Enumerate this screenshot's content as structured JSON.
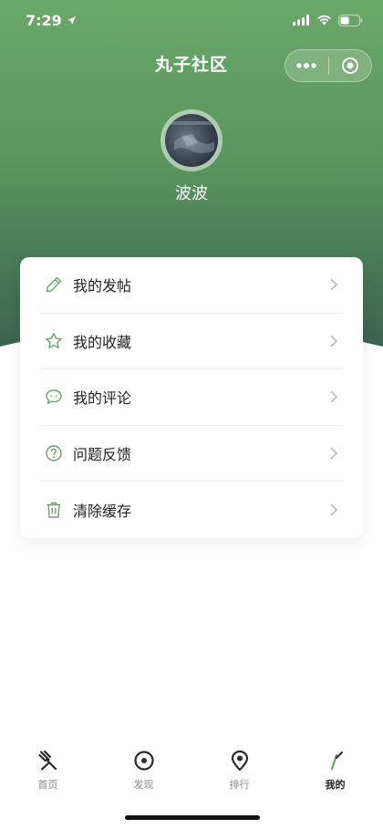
{
  "status": {
    "time": "7:29"
  },
  "app": {
    "title": "丸子社区"
  },
  "user": {
    "name": "波波"
  },
  "colors": {
    "accent": "#6aa06a",
    "hero_top": "#5e9a62",
    "hero_bottom": "#3c6b52"
  },
  "menu": [
    {
      "label": "我的发帖",
      "icon": "pencil-icon"
    },
    {
      "label": "我的收藏",
      "icon": "star-icon"
    },
    {
      "label": "我的评论",
      "icon": "comment-icon"
    },
    {
      "label": "问题反馈",
      "icon": "question-icon"
    },
    {
      "label": "清除缓存",
      "icon": "trash-icon"
    }
  ],
  "tabbar": [
    {
      "label": "首页",
      "icon": "fork-icon",
      "active": false
    },
    {
      "label": "发现",
      "icon": "compass-icon",
      "active": false
    },
    {
      "label": "排行",
      "icon": "location-pin-icon",
      "active": false
    },
    {
      "label": "我的",
      "icon": "profile-stroke-icon",
      "active": true
    }
  ]
}
